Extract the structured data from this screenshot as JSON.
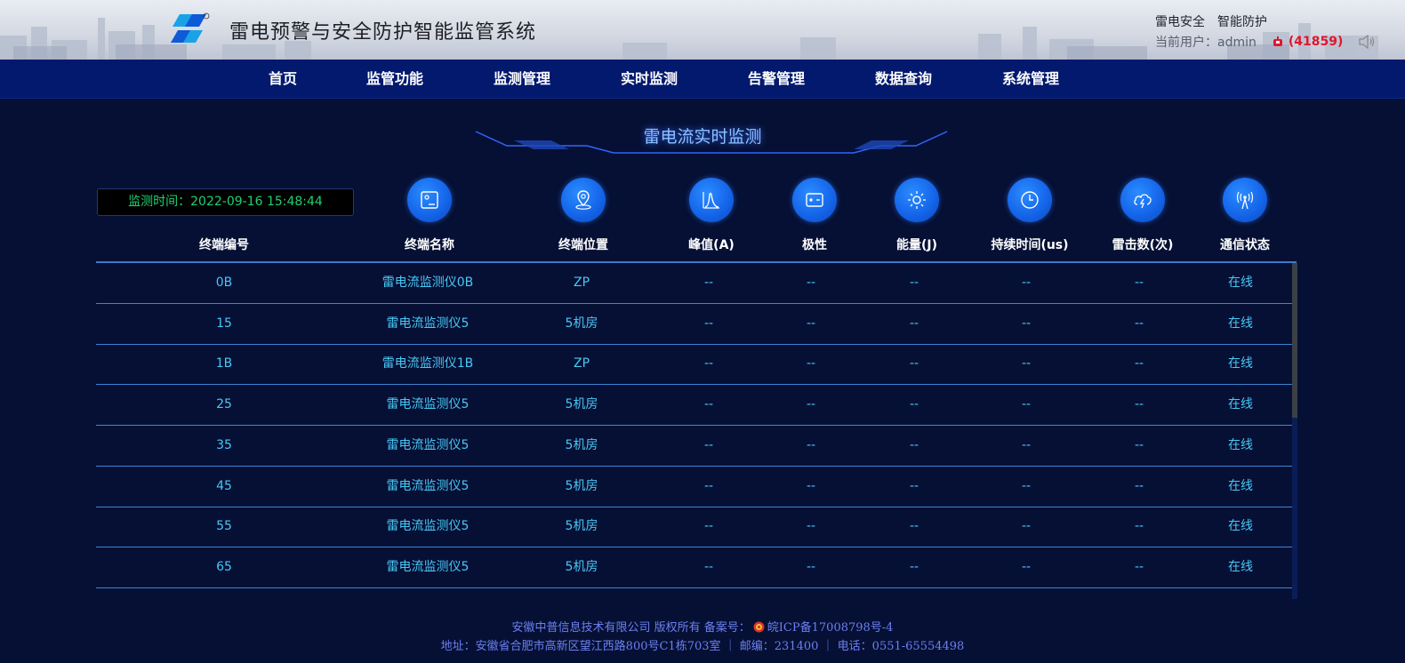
{
  "header": {
    "system_title": "雷电预警与安全防护智能监管系统",
    "tagline_1": "雷电安全",
    "tagline_2": "智能防护",
    "current_user_label": "当前用户：admin",
    "alarm_count": "(41859)"
  },
  "nav": {
    "items": [
      "首页",
      "监管功能",
      "监测管理",
      "实时监测",
      "告警管理",
      "数据查询",
      "系统管理"
    ]
  },
  "section": {
    "title": "雷电流实时监测"
  },
  "monitor": {
    "time_label": "监测时间：2022-09-16 15:48:44"
  },
  "table": {
    "columns": [
      "终端编号",
      "终端名称",
      "终端位置",
      "峰值(A)",
      "极性",
      "能量(J)",
      "持续时间(us)",
      "雷击数(次)",
      "通信状态"
    ],
    "column_icons": [
      "terminal-name-icon",
      "location-pin-icon",
      "peak-waveform-icon",
      "polarity-icon",
      "energy-sun-icon",
      "duration-clock-icon",
      "lightning-cloud-icon",
      "signal-tower-icon"
    ],
    "rows": [
      [
        "0B",
        "雷电流监测仪0B",
        "ZP",
        "--",
        "--",
        "--",
        "--",
        "--",
        "在线"
      ],
      [
        "15",
        "雷电流监测仪5",
        "5机房",
        "--",
        "--",
        "--",
        "--",
        "--",
        "在线"
      ],
      [
        "1B",
        "雷电流监测仪1B",
        "ZP",
        "--",
        "--",
        "--",
        "--",
        "--",
        "在线"
      ],
      [
        "25",
        "雷电流监测仪5",
        "5机房",
        "--",
        "--",
        "--",
        "--",
        "--",
        "在线"
      ],
      [
        "35",
        "雷电流监测仪5",
        "5机房",
        "--",
        "--",
        "--",
        "--",
        "--",
        "在线"
      ],
      [
        "45",
        "雷电流监测仪5",
        "5机房",
        "--",
        "--",
        "--",
        "--",
        "--",
        "在线"
      ],
      [
        "55",
        "雷电流监测仪5",
        "5机房",
        "--",
        "--",
        "--",
        "--",
        "--",
        "在线"
      ],
      [
        "65",
        "雷电流监测仪5",
        "5机房",
        "--",
        "--",
        "--",
        "--",
        "--",
        "在线"
      ]
    ]
  },
  "footer": {
    "line1_a": "安徽中普信息技术有限公司 版权所有 备案号：",
    "line1_b": "皖ICP备17008798号-4",
    "line2": "地址：安徽省合肥市高新区望江西路800号C1栋703室 ｜ 邮编：231400 ｜ 电话：0551-65554498"
  },
  "colors": {
    "background": "#061035",
    "nav_bg": "#02196e",
    "cell_text": "#49c7f4",
    "alarm_red": "#e0182c",
    "time_green": "#20d070",
    "icon_blue": "#1566ea"
  }
}
